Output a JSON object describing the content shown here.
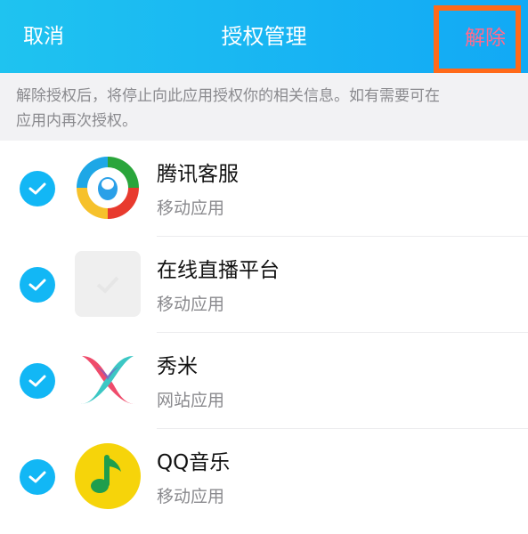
{
  "header": {
    "cancel_label": "取消",
    "title": "授权管理",
    "revoke_label": "解除"
  },
  "notice": {
    "line1": "解除授权后，将停止向此应用授权你的相关信息。如有需要可在",
    "line2": "应用内再次授权。"
  },
  "apps": [
    {
      "name": "腾讯客服",
      "type": "移动应用",
      "icon": "tencent-support-icon",
      "checked": true
    },
    {
      "name": "在线直播平台",
      "type": "移动应用",
      "icon": "placeholder-app-icon",
      "checked": true
    },
    {
      "name": "秀米",
      "type": "网站应用",
      "icon": "xiumi-icon",
      "checked": true
    },
    {
      "name": "QQ音乐",
      "type": "移动应用",
      "icon": "qq-music-icon",
      "checked": true
    }
  ],
  "colors": {
    "header_start": "#1fc3f0",
    "header_end": "#12a9f5",
    "check": "#12b7f5",
    "revoke_text": "#ff6b8e",
    "highlight_border": "#ff6a1a"
  }
}
